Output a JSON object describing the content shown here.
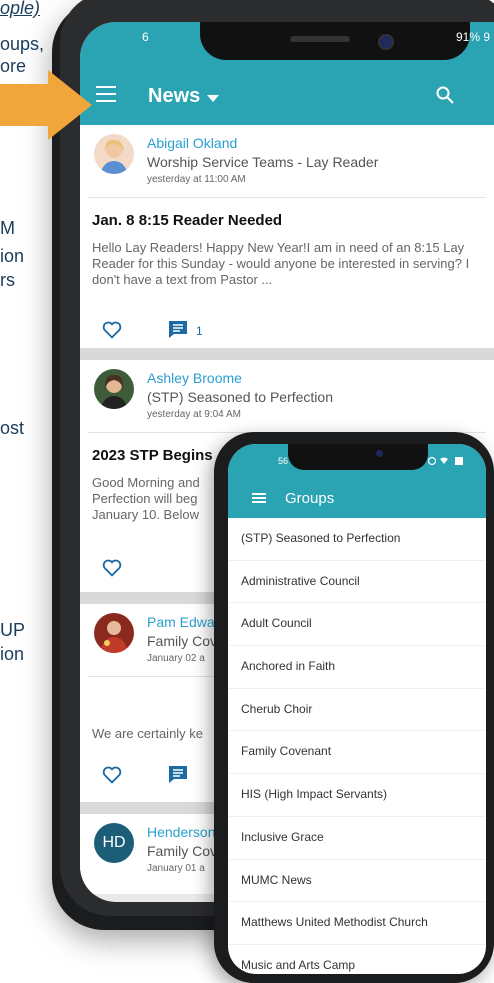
{
  "left_text": {
    "line1": "ople)",
    "line2": "oups,",
    "line3": "ore",
    "line4": "M",
    "line5": "ion",
    "line6": "rs",
    "line7": "ost",
    "line8": "UP",
    "line9": "ion"
  },
  "phone1": {
    "status": {
      "left": "6",
      "right": "91% 9"
    },
    "appbar": {
      "title": "News"
    },
    "posts": [
      {
        "author": "Abigail Okland",
        "group": "Worship Service Teams - Lay Reader",
        "time": "yesterday at 11:00 AM",
        "title": "Jan. 8 8:15 Reader Needed",
        "body": "Hello Lay Readers! Happy New Year!I am in need of an 8:15 Lay Reader for this Sunday - would anyone be interested in serving? I don't have a text from Pastor ...",
        "comments": "1"
      },
      {
        "author": "Ashley Broome",
        "group": "(STP) Seasoned to Perfection",
        "time": "yesterday at 9:04 AM",
        "title": "2023 STP Begins",
        "body": "Good Morning and Perfection will beg January 10. Below"
      },
      {
        "author": "Pam Edwa",
        "group": "Family Cov",
        "time": "January 02 a",
        "body": "We are certainly ke"
      },
      {
        "author": "Henderson",
        "group": "Family Cov",
        "time": "January 01 a",
        "initials": "HD"
      }
    ]
  },
  "phone2": {
    "status": {
      "left": "56"
    },
    "appbar": {
      "title": "Groups"
    },
    "groups": [
      "(STP) Seasoned to Perfection",
      "Administrative Council",
      "Adult Council",
      "Anchored in Faith",
      "Cherub Choir",
      "Family Covenant",
      "HIS (High Impact Servants)",
      "Inclusive Grace",
      "MUMC News",
      "Matthews United Methodist Church",
      "Music and Arts Camp"
    ]
  },
  "colors": {
    "accent": "#2aa3b2",
    "arrow": "#f0a63a",
    "link": "#2a9fcf"
  }
}
